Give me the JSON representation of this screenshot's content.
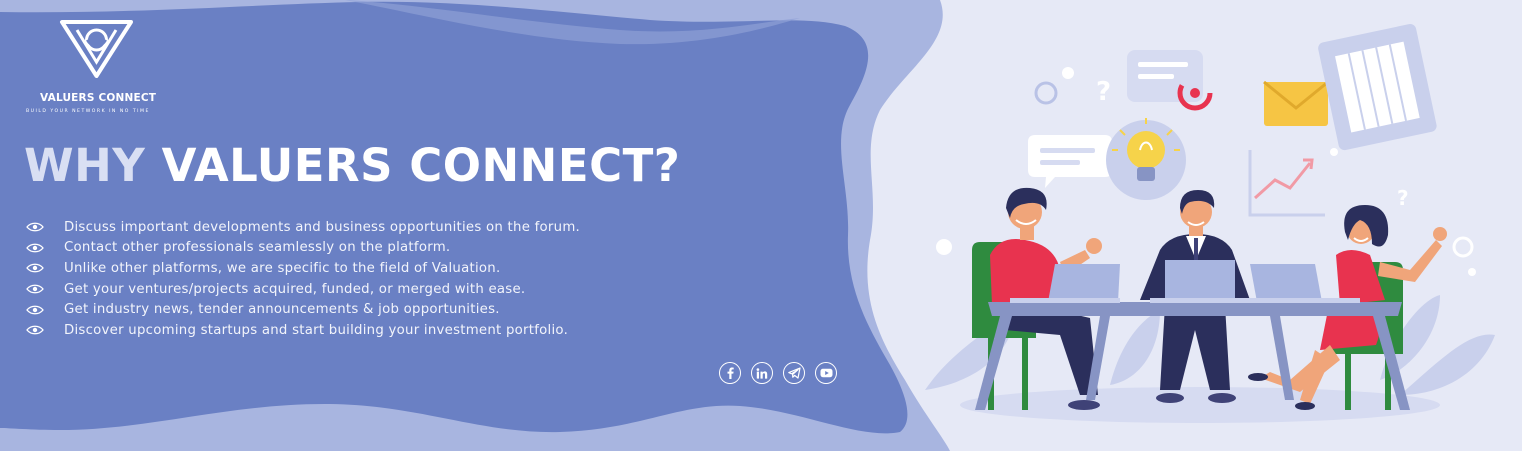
{
  "brand": {
    "name": "VALUERS CONNECT",
    "tagline": "BUILD YOUR NETWORK IN NO TIME"
  },
  "headline": {
    "part1": "WHY",
    "part2": "VALUERS CONNECT?"
  },
  "features": [
    "Discuss important developments and business opportunities on the forum.",
    "Contact other professionals seamlessly on the platform.",
    "Unlike other platforms, we are specific to the field of Valuation.",
    "Get your ventures/projects acquired, funded, or merged with ease.",
    "Get industry news, tender announcements & job opportunities.",
    "Discover upcoming startups and start building your investment portfolio."
  ],
  "social": [
    {
      "icon": "facebook-icon",
      "glyph": "f"
    },
    {
      "icon": "linkedin-icon",
      "glyph": "in"
    },
    {
      "icon": "telegram-icon"
    },
    {
      "icon": "youtube-icon"
    }
  ],
  "colors": {
    "panel": "#6a80c4",
    "wave": "#a8b5e0",
    "page": "#e6e9f6",
    "headline_accent": "#d9dff3",
    "shirt_red": "#e8334f",
    "chair_green": "#2f8b3f",
    "suit_navy": "#2b2f5c"
  }
}
